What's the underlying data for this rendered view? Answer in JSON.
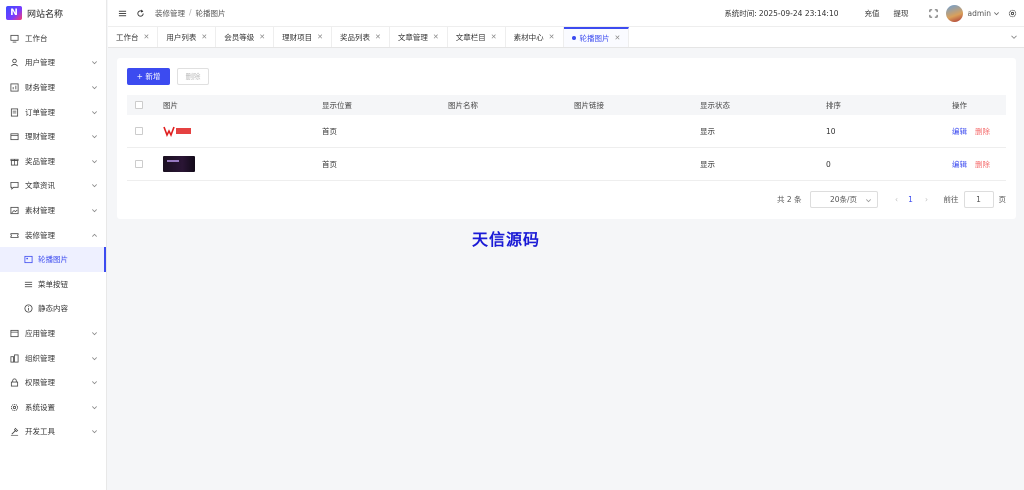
{
  "brand": {
    "name": "网站名称"
  },
  "sidebar": {
    "items": [
      {
        "label": "工作台",
        "icon": "monitor-icon"
      },
      {
        "label": "用户管理",
        "icon": "user-icon"
      },
      {
        "label": "财务管理",
        "icon": "chart-icon"
      },
      {
        "label": "订单管理",
        "icon": "order-icon"
      },
      {
        "label": "理财管理",
        "icon": "wallet-icon"
      },
      {
        "label": "奖品管理",
        "icon": "gift-icon"
      },
      {
        "label": "文章资讯",
        "icon": "message-icon"
      },
      {
        "label": "素材管理",
        "icon": "image-icon"
      },
      {
        "label": "装修管理",
        "icon": "ticket-icon"
      }
    ],
    "sub_items": [
      {
        "label": "轮播图片",
        "icon": "image-icon"
      },
      {
        "label": "菜单按钮",
        "icon": "list-icon"
      },
      {
        "label": "静态内容",
        "icon": "info-icon"
      }
    ],
    "items_after": [
      {
        "label": "应用管理",
        "icon": "app-icon"
      },
      {
        "label": "组织管理",
        "icon": "org-icon"
      },
      {
        "label": "权限管理",
        "icon": "lock-icon"
      },
      {
        "label": "系统设置",
        "icon": "gear-icon"
      },
      {
        "label": "开发工具",
        "icon": "tool-icon"
      }
    ]
  },
  "header": {
    "breadcrumb": [
      "装修管理",
      "轮播图片"
    ],
    "breadcrumb_sep": "/",
    "system_time_label": "系统时间:",
    "system_time": "2025-09-24 23:14:10",
    "recharge": "充值",
    "withdraw": "提现",
    "username": "admin"
  },
  "tabs": [
    {
      "label": "工作台"
    },
    {
      "label": "用户列表"
    },
    {
      "label": "会员等级"
    },
    {
      "label": "理财项目"
    },
    {
      "label": "奖品列表"
    },
    {
      "label": "文章管理"
    },
    {
      "label": "文章栏目"
    },
    {
      "label": "素材中心"
    },
    {
      "label": "轮播图片",
      "active": true
    }
  ],
  "toolbar": {
    "add_label": "+ 新增",
    "delete_label": "删除"
  },
  "table": {
    "columns": [
      "图片",
      "显示位置",
      "图片名称",
      "图片链接",
      "显示状态",
      "排序",
      "操作"
    ],
    "rows": [
      {
        "position": "首页",
        "name": "",
        "link": "",
        "status": "显示",
        "sort": "10",
        "edit": "编辑",
        "delete": "删除"
      },
      {
        "position": "首页",
        "name": "",
        "link": "",
        "status": "显示",
        "sort": "0",
        "edit": "编辑",
        "delete": "删除"
      }
    ]
  },
  "pagination": {
    "total": "共 2 条",
    "page_size": "20条/页",
    "current_page": "1",
    "goto_label": "前往",
    "goto_value": "1",
    "page_suffix": "页"
  },
  "watermark": "天信源码",
  "colors": {
    "accent": "#3c4bf0",
    "danger": "#f56c6c"
  }
}
